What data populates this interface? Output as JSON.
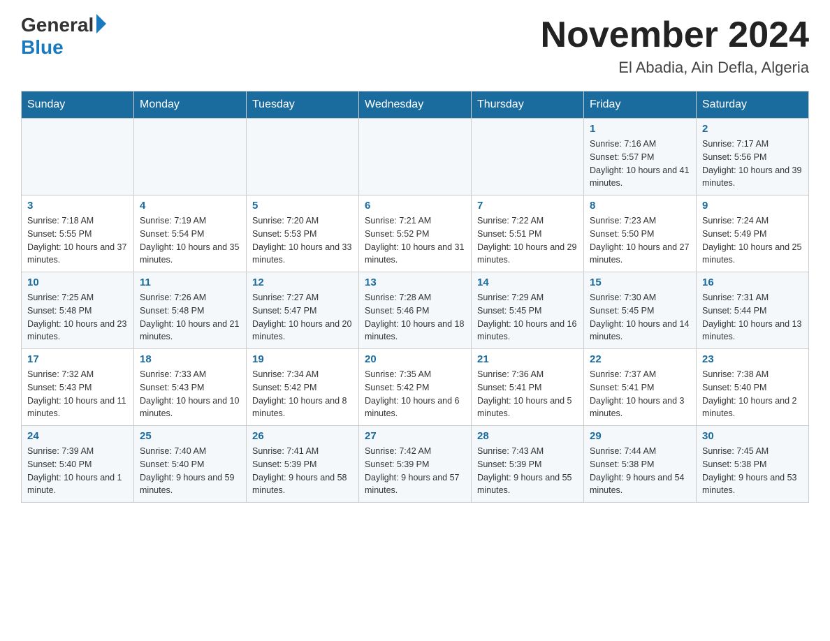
{
  "header": {
    "logo_text": "General",
    "logo_blue": "Blue",
    "month_year": "November 2024",
    "location": "El Abadia, Ain Defla, Algeria"
  },
  "weekdays": [
    "Sunday",
    "Monday",
    "Tuesday",
    "Wednesday",
    "Thursday",
    "Friday",
    "Saturday"
  ],
  "weeks": [
    [
      {
        "day": "",
        "info": ""
      },
      {
        "day": "",
        "info": ""
      },
      {
        "day": "",
        "info": ""
      },
      {
        "day": "",
        "info": ""
      },
      {
        "day": "",
        "info": ""
      },
      {
        "day": "1",
        "info": "Sunrise: 7:16 AM\nSunset: 5:57 PM\nDaylight: 10 hours and 41 minutes."
      },
      {
        "day": "2",
        "info": "Sunrise: 7:17 AM\nSunset: 5:56 PM\nDaylight: 10 hours and 39 minutes."
      }
    ],
    [
      {
        "day": "3",
        "info": "Sunrise: 7:18 AM\nSunset: 5:55 PM\nDaylight: 10 hours and 37 minutes."
      },
      {
        "day": "4",
        "info": "Sunrise: 7:19 AM\nSunset: 5:54 PM\nDaylight: 10 hours and 35 minutes."
      },
      {
        "day": "5",
        "info": "Sunrise: 7:20 AM\nSunset: 5:53 PM\nDaylight: 10 hours and 33 minutes."
      },
      {
        "day": "6",
        "info": "Sunrise: 7:21 AM\nSunset: 5:52 PM\nDaylight: 10 hours and 31 minutes."
      },
      {
        "day": "7",
        "info": "Sunrise: 7:22 AM\nSunset: 5:51 PM\nDaylight: 10 hours and 29 minutes."
      },
      {
        "day": "8",
        "info": "Sunrise: 7:23 AM\nSunset: 5:50 PM\nDaylight: 10 hours and 27 minutes."
      },
      {
        "day": "9",
        "info": "Sunrise: 7:24 AM\nSunset: 5:49 PM\nDaylight: 10 hours and 25 minutes."
      }
    ],
    [
      {
        "day": "10",
        "info": "Sunrise: 7:25 AM\nSunset: 5:48 PM\nDaylight: 10 hours and 23 minutes."
      },
      {
        "day": "11",
        "info": "Sunrise: 7:26 AM\nSunset: 5:48 PM\nDaylight: 10 hours and 21 minutes."
      },
      {
        "day": "12",
        "info": "Sunrise: 7:27 AM\nSunset: 5:47 PM\nDaylight: 10 hours and 20 minutes."
      },
      {
        "day": "13",
        "info": "Sunrise: 7:28 AM\nSunset: 5:46 PM\nDaylight: 10 hours and 18 minutes."
      },
      {
        "day": "14",
        "info": "Sunrise: 7:29 AM\nSunset: 5:45 PM\nDaylight: 10 hours and 16 minutes."
      },
      {
        "day": "15",
        "info": "Sunrise: 7:30 AM\nSunset: 5:45 PM\nDaylight: 10 hours and 14 minutes."
      },
      {
        "day": "16",
        "info": "Sunrise: 7:31 AM\nSunset: 5:44 PM\nDaylight: 10 hours and 13 minutes."
      }
    ],
    [
      {
        "day": "17",
        "info": "Sunrise: 7:32 AM\nSunset: 5:43 PM\nDaylight: 10 hours and 11 minutes."
      },
      {
        "day": "18",
        "info": "Sunrise: 7:33 AM\nSunset: 5:43 PM\nDaylight: 10 hours and 10 minutes."
      },
      {
        "day": "19",
        "info": "Sunrise: 7:34 AM\nSunset: 5:42 PM\nDaylight: 10 hours and 8 minutes."
      },
      {
        "day": "20",
        "info": "Sunrise: 7:35 AM\nSunset: 5:42 PM\nDaylight: 10 hours and 6 minutes."
      },
      {
        "day": "21",
        "info": "Sunrise: 7:36 AM\nSunset: 5:41 PM\nDaylight: 10 hours and 5 minutes."
      },
      {
        "day": "22",
        "info": "Sunrise: 7:37 AM\nSunset: 5:41 PM\nDaylight: 10 hours and 3 minutes."
      },
      {
        "day": "23",
        "info": "Sunrise: 7:38 AM\nSunset: 5:40 PM\nDaylight: 10 hours and 2 minutes."
      }
    ],
    [
      {
        "day": "24",
        "info": "Sunrise: 7:39 AM\nSunset: 5:40 PM\nDaylight: 10 hours and 1 minute."
      },
      {
        "day": "25",
        "info": "Sunrise: 7:40 AM\nSunset: 5:40 PM\nDaylight: 9 hours and 59 minutes."
      },
      {
        "day": "26",
        "info": "Sunrise: 7:41 AM\nSunset: 5:39 PM\nDaylight: 9 hours and 58 minutes."
      },
      {
        "day": "27",
        "info": "Sunrise: 7:42 AM\nSunset: 5:39 PM\nDaylight: 9 hours and 57 minutes."
      },
      {
        "day": "28",
        "info": "Sunrise: 7:43 AM\nSunset: 5:39 PM\nDaylight: 9 hours and 55 minutes."
      },
      {
        "day": "29",
        "info": "Sunrise: 7:44 AM\nSunset: 5:38 PM\nDaylight: 9 hours and 54 minutes."
      },
      {
        "day": "30",
        "info": "Sunrise: 7:45 AM\nSunset: 5:38 PM\nDaylight: 9 hours and 53 minutes."
      }
    ]
  ]
}
